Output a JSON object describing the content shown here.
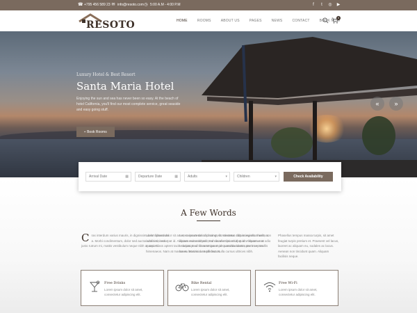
{
  "topbar": {
    "phone": "+795 456 589 23",
    "email": "info@resoto.com",
    "hours": "5:00 A.M - 4:00 P.M"
  },
  "header": {
    "logo_text": "RESOTO",
    "nav": [
      "HOME",
      "ROOMS",
      "ABOUT US",
      "PAGES",
      "NEWS",
      "CONTACT",
      "BOOK NOW"
    ],
    "active_nav": "HOME",
    "cart_count": "0"
  },
  "hero": {
    "subtitle": "Luxury Hotel & Best Resort",
    "title": "Santa Maria Hotel",
    "description": "Enjoying the sun and sea has never been so easy. At the beach of hotel California, you'll find our most complete service, great seaside and easy going stuff.",
    "button_label": "Book Rooms",
    "prev_arrow": "«",
    "next_arrow": "»"
  },
  "booking": {
    "arrival_placeholder": "Arrival Date",
    "departure_placeholder": "Departure Date",
    "adults_label": "Adults",
    "children_label": "Children",
    "submit_label": "Check Availability"
  },
  "about": {
    "title": "A Few Words",
    "dropcap": "C",
    "col1": "ras interdum varius mauris, in dignissim dolor bibendum a. Morbi condimentum, dolor sed auctor ultricies, sem justo rutrum mi, mattis vestibulum neque nibh at sapien.",
    "col2": "Lorem ipsum dolor sit amet, consectetur adipiscing elit. Vivamus dictum euismod velit, non iaculis nisi volutpat id. Aliquam erat volutpat. Sed sit amet ipsum id quam tincidunt rutrum nec mollis lorem. Mauris a neque lectus.",
    "col3": "Lorem ipsum dolor sit amet, consectetur adipiscing elit. Vivamus dictum euismod velit, non iaculis nisi volutpat id. Aliquam erat volutpat. Sed sit amet ipsum id quam. Vivamus at odio quam. Class aptent taciti sociosqu ad litora torquent per conubia nostra, per inceptos himenaeos. Nam at massa eu leo tincidunt efficitur. Nulla cursus ultrices nibh.",
    "col4": "Phasellus tempus massa turpis, sit amet feugiat turpis pretium et. Praesent vel lacus, laoreet ac aliquam eu, sodales ac lacus. Aenean non tincidunt quam. Aliquam facilisis neque."
  },
  "features": [
    {
      "title": "Free Drinks",
      "desc": "Lorem ipsum dolor sit amet, consectetur adipiscing elit.",
      "icon": "cocktail-icon"
    },
    {
      "title": "Bike Rental",
      "desc": "Lorem ipsum dolor sit amet, consectetur adipiscing elit.",
      "icon": "bicycle-icon"
    },
    {
      "title": "Free Wi-Fi",
      "desc": "Lorem ipsum dolor sit amet, consectetur adipiscing elit.",
      "icon": "wifi-icon"
    }
  ],
  "colors": {
    "brand": "#7a6a5e",
    "dark": "#3e3129"
  }
}
